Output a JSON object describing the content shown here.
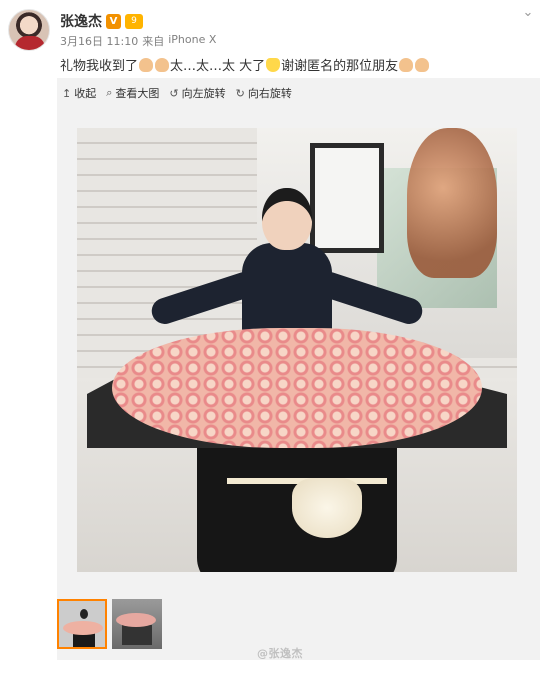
{
  "header": {
    "username": "张逸杰",
    "vip_badge": "V",
    "level_badge": "9",
    "date": "3月16日 11:10",
    "source_prefix": "来自",
    "source": "iPhone X",
    "more_icon": "chevron-down-icon"
  },
  "post": {
    "text_part1": "礼物我收到了",
    "text_part2": "太…太…太 大了",
    "text_part3": "谢谢匿名的那位朋友"
  },
  "toolbar": {
    "collapse_label": "收起",
    "view_large_label": "查看大图",
    "rotate_left_label": "向左旋转",
    "rotate_right_label": "向右旋转"
  },
  "watermark": "@张逸杰",
  "colors": {
    "accent": "#ff8200",
    "vip": "#f29100",
    "meta_text": "#808080"
  }
}
